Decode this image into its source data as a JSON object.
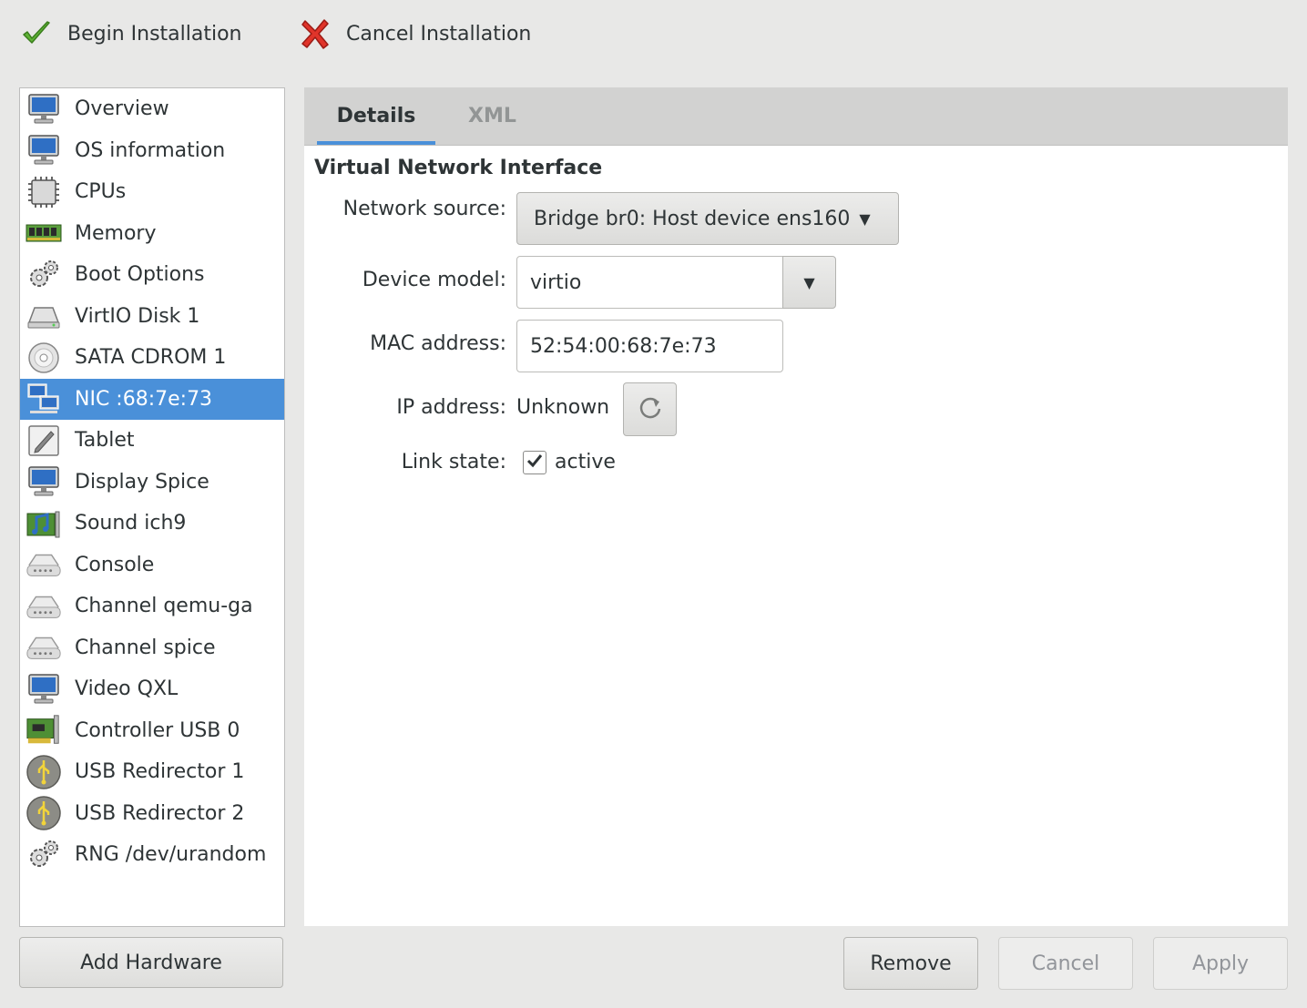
{
  "toolbar": {
    "begin_label": "Begin Installation",
    "cancel_label": "Cancel Installation"
  },
  "sidebar": {
    "items": [
      {
        "label": "Overview",
        "icon": "monitor-icon"
      },
      {
        "label": "OS information",
        "icon": "monitor-icon"
      },
      {
        "label": "CPUs",
        "icon": "cpu-chip-icon"
      },
      {
        "label": "Memory",
        "icon": "memory-module-icon"
      },
      {
        "label": "Boot Options",
        "icon": "gears-icon"
      },
      {
        "label": "VirtIO Disk 1",
        "icon": "hard-disk-icon"
      },
      {
        "label": "SATA CDROM 1",
        "icon": "cdrom-icon"
      },
      {
        "label": "NIC :68:7e:73",
        "icon": "network-icon"
      },
      {
        "label": "Tablet",
        "icon": "tablet-icon"
      },
      {
        "label": "Display Spice",
        "icon": "monitor-icon"
      },
      {
        "label": "Sound ich9",
        "icon": "sound-card-icon"
      },
      {
        "label": "Console",
        "icon": "serial-port-icon"
      },
      {
        "label": "Channel qemu-ga",
        "icon": "serial-port-icon"
      },
      {
        "label": "Channel spice",
        "icon": "serial-port-icon"
      },
      {
        "label": "Video QXL",
        "icon": "monitor-icon"
      },
      {
        "label": "Controller USB 0",
        "icon": "pci-card-icon"
      },
      {
        "label": "USB Redirector 1",
        "icon": "usb-icon"
      },
      {
        "label": "USB Redirector 2",
        "icon": "usb-icon"
      },
      {
        "label": "RNG /dev/urandom",
        "icon": "gears-icon"
      }
    ],
    "selected_index": 7,
    "add_hardware_label": "Add Hardware"
  },
  "tabs": {
    "details": "Details",
    "xml": "XML"
  },
  "nic": {
    "section_title": "Virtual Network Interface",
    "network_source_label": "Network source:",
    "network_source_value": "Bridge br0: Host device ens160",
    "device_model_label": "Device model:",
    "device_model_value": "virtio",
    "mac_label": "MAC address:",
    "mac_value": "52:54:00:68:7e:73",
    "ip_label": "IP address:",
    "ip_value": "Unknown",
    "link_state_label": "Link state:",
    "link_state_value": "active",
    "link_state_checked": true
  },
  "footer": {
    "remove_label": "Remove",
    "cancel_label": "Cancel",
    "apply_label": "Apply"
  },
  "colors": {
    "accent": "#4a90d9",
    "window_bg": "#e8e8e7"
  }
}
